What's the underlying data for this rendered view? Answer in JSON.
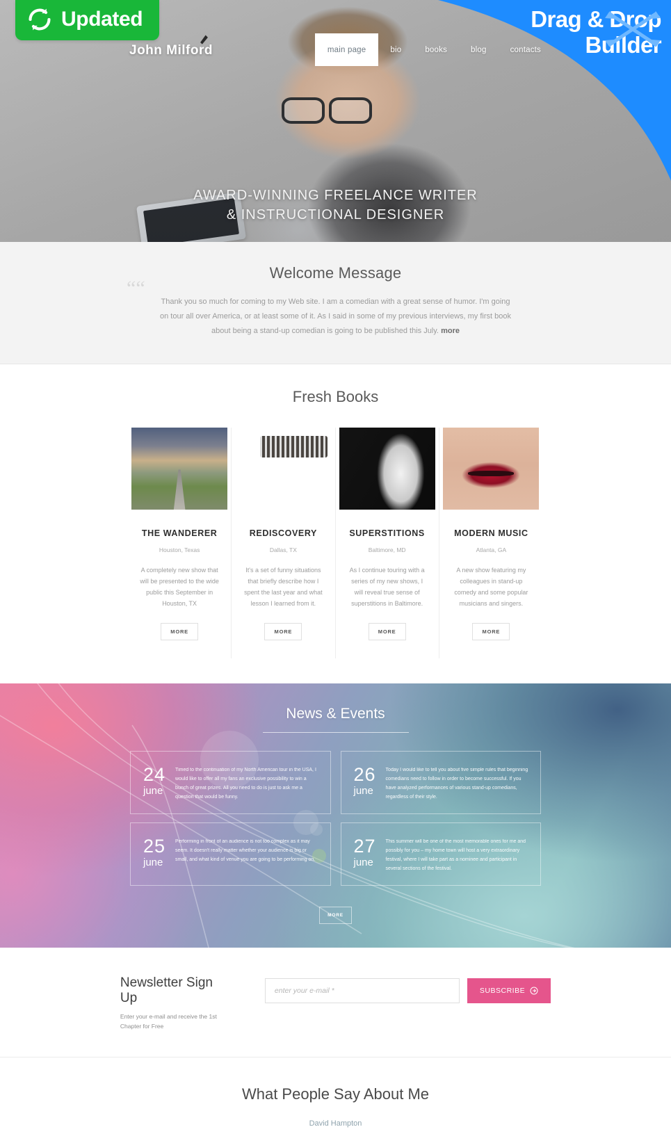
{
  "badges": {
    "updated_label": "Updated",
    "updated_icon": "refresh-icon",
    "updated_color": "#19b739",
    "corner_line1": "Drag & Drop",
    "corner_line2": "Builder",
    "corner_color": "#1e8cff",
    "corner_icon": "four-way-arrows-icon"
  },
  "header": {
    "logo": "John Milford",
    "logo_icon": "quill-pen-icon",
    "nav": [
      {
        "label": "main page",
        "active": true
      },
      {
        "label": "bio",
        "active": false
      },
      {
        "label": "books",
        "active": false
      },
      {
        "label": "blog",
        "active": false
      },
      {
        "label": "contacts",
        "active": false
      }
    ]
  },
  "hero": {
    "headline_line1": "AWARD-WINNING FREELANCE WRITER",
    "headline_line2": "& INSTRUCTIONAL DESIGNER"
  },
  "welcome": {
    "title": "Welcome Message",
    "quote_glyph": "“",
    "body": "Thank you so much for coming to my Web site. I am a comedian with a great sense of humor. I'm going on tour all over America, or at least some of it. As I said in some of my previous interviews, my first book about being a stand-up comedian is going to be published this July.",
    "more_label": "more"
  },
  "books": {
    "title": "Fresh Books",
    "items": [
      {
        "title": "THE WANDERER",
        "location": "Houston, Texas",
        "description": "A completely new show that will be presented to the wide public this September in Houston, TX",
        "button": "MORE",
        "image": "open-road-storm-photo"
      },
      {
        "title": "REDISCOVERY",
        "location": "Dallas, TX",
        "description": "It's a set of funny situations that briefly describe how I spent the last year and what lesson I learned from it.",
        "button": "MORE",
        "image": "blindfolded-woman-photo"
      },
      {
        "title": "SUPERSTITIONS",
        "location": "Baltimore, MD",
        "description": "As I continue touring with a series of my new shows, I will reveal true sense of superstitions in Baltimore.",
        "button": "MORE",
        "image": "monochrome-torso-photo"
      },
      {
        "title": "MODERN MUSIC",
        "location": "Atlanta, GA",
        "description": "A new show featuring my colleagues in stand-up comedy and some popular musicians and singers.",
        "button": "MORE",
        "image": "red-lips-photo"
      }
    ]
  },
  "news": {
    "title": "News & Events",
    "more_label": "MORE",
    "items": [
      {
        "day": "24",
        "month": "june",
        "text": "Timed to the continuation of my North American tour in the USA, I would like to offer all my fans an exclusive possibility to win a bunch of great prizes. All you need to do is just to ask me a question that would be funny."
      },
      {
        "day": "26",
        "month": "june",
        "text": "Today I would like to tell you about five simple rules that beginning comedians need to follow in order to become successful. If you have analyzed performances of various stand-up comedians, regardless of their style."
      },
      {
        "day": "25",
        "month": "june",
        "text": "Performing in front of an audience is not too complex as it may seem. It doesn't really matter whether your audience is big or small, and what kind of venue you are going to be performing on."
      },
      {
        "day": "27",
        "month": "june",
        "text": "This summer will be one of the most memorable ones for me and possibly for you – my home town will host a very extraordinary festival, where I will take part as a nominee and participant in several sections of the festival."
      }
    ]
  },
  "newsletter": {
    "title": "Newsletter Sign Up",
    "subtitle": "Enter your e-mail and receive the 1st Chapter for Free",
    "placeholder": "enter your e-mail *",
    "value": "",
    "button": "SUBSCRIBE",
    "button_icon": "arrow-right-circle-icon",
    "accent_color": "#e5558c"
  },
  "testimonials": {
    "title": "What People Say About Me",
    "author": "David Hampton"
  }
}
